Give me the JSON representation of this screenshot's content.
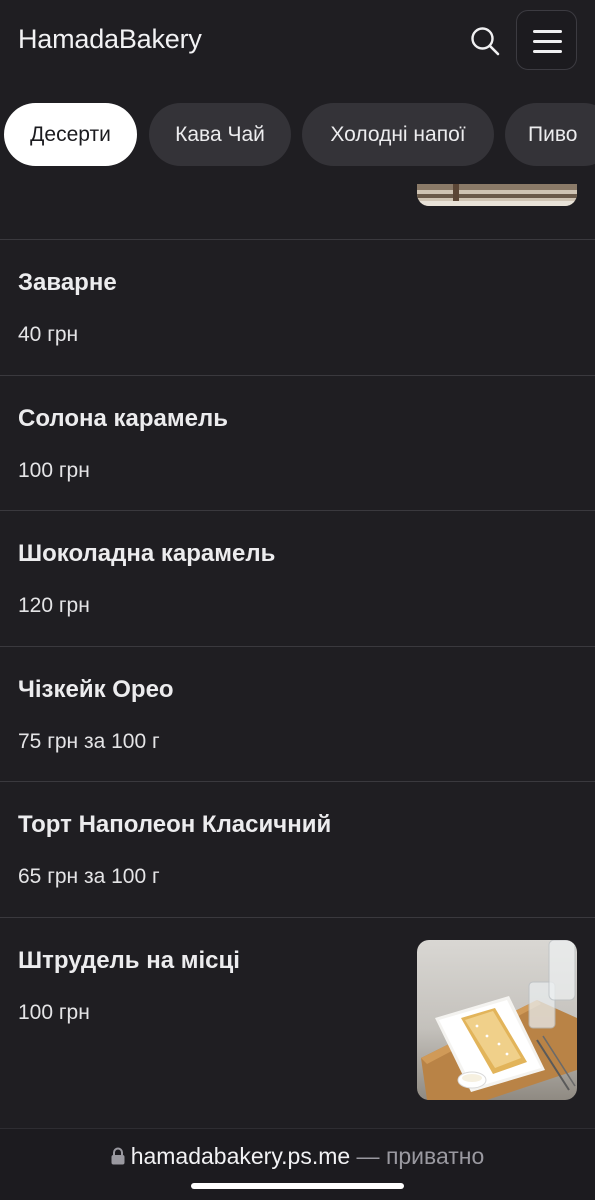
{
  "header": {
    "brand": "HamadaBakery",
    "search_icon": "search-icon",
    "menu_icon": "hamburger-menu-icon"
  },
  "categories": [
    {
      "label": "Десерти",
      "active": true
    },
    {
      "label": "Кава Чай",
      "active": false
    },
    {
      "label": "Холодні напої",
      "active": false
    },
    {
      "label": "Пиво",
      "active": false
    }
  ],
  "items": [
    {
      "name": "Заварне",
      "price": "40 грн"
    },
    {
      "name": "Солона карамель",
      "price": "100 грн"
    },
    {
      "name": "Шоколадна карамель",
      "price": "120 грн"
    },
    {
      "name": "Чізкейк Орео",
      "price": "75 грн за 100 г"
    },
    {
      "name": "Торт Наполеон Класичний",
      "price": "65 грн за 100 г"
    },
    {
      "name": "Штрудель на місці",
      "price": "100 грн"
    }
  ],
  "footer": {
    "lock_icon": "lock-icon",
    "host": "hamadabakery.ps.me",
    "separator": " — ",
    "status": "приватно"
  },
  "colors": {
    "background": "#1f1e22",
    "chip": "#343338",
    "chip_active": "#ffffff",
    "divider": "#3a393e"
  }
}
